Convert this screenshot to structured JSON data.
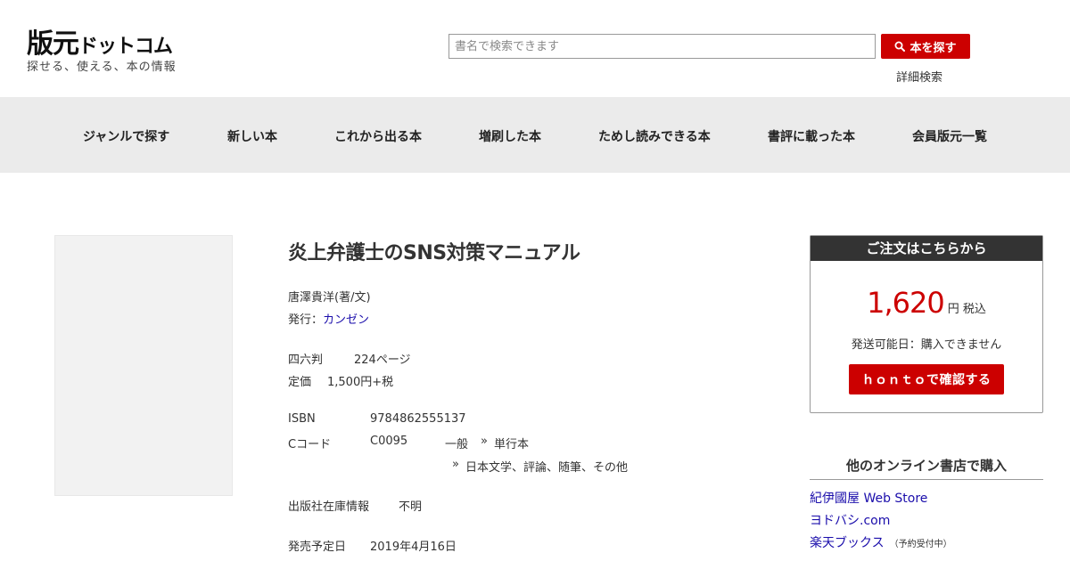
{
  "header": {
    "logo_main": "版元",
    "logo_sub": "ドットコム",
    "tagline": "探せる、使える、本の情報",
    "search_placeholder": "書名で検索できます",
    "search_button": "本を探す",
    "advanced_search": "詳細検索"
  },
  "nav": {
    "items": [
      {
        "label": "ジャンルで探す"
      },
      {
        "label": "新しい本"
      },
      {
        "label": "これから出る本"
      },
      {
        "label": "増刷した本"
      },
      {
        "label": "ためし読みできる本"
      },
      {
        "label": "書評に載った本"
      },
      {
        "label": "会員版元一覧"
      }
    ]
  },
  "book": {
    "title": "炎上弁護士のSNS対策マニュアル",
    "author": "唐澤貴洋(著/文)",
    "publisher_label": "発行：",
    "publisher": "カンゼン",
    "format": "四六判",
    "pages": "224ページ",
    "price_label": "定価",
    "price": "1,500円+税",
    "isbn_label": "ISBN",
    "isbn": "9784862555137",
    "ccode_label": "Cコード",
    "ccode": "C0095",
    "ccode_target": "一般",
    "ccode_form": "単行本",
    "ccode_content": "日本文学、評論、随筆、その他",
    "sep": "»",
    "stock_label": "出版社在庫情報",
    "stock": "不明",
    "release_label": "発売予定日",
    "release": "2019年4月16日"
  },
  "order": {
    "heading": "ご注文はこちらから",
    "price": "1,620",
    "price_unit": "円 税込",
    "shipping": "発送可能日：購入できません",
    "honto_button": "ｈｏｎｔｏで確認する"
  },
  "other_stores": {
    "heading": "他のオンライン書店で購入",
    "stores": [
      {
        "name": "紀伊國屋 Web Store",
        "note": ""
      },
      {
        "name": "ヨドバシ.com",
        "note": ""
      },
      {
        "name": "楽天ブックス",
        "note": "（予約受付中）"
      }
    ]
  },
  "colors": {
    "accent": "#cc0000",
    "nav_bg": "#ebebeb",
    "link": "#1a0dab",
    "order_header": "#333333"
  },
  "icons": {
    "search_button_icon": "search-icon"
  }
}
